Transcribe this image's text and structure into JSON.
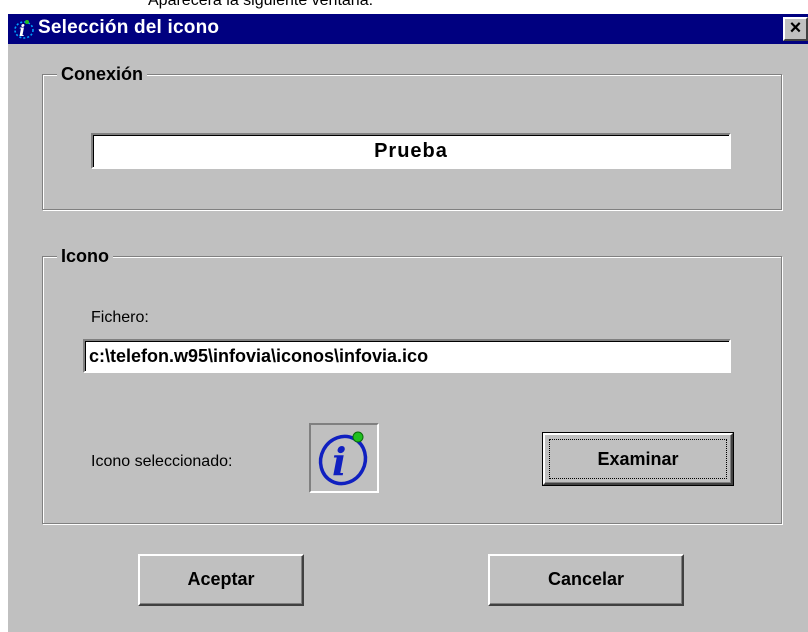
{
  "document": {
    "caption": "Aparecerá la siguiente ventana:"
  },
  "window": {
    "title": "Selección del icono",
    "title_icon": "infovia-icon",
    "close_label": "×"
  },
  "conexion": {
    "legend": "Conexión",
    "value": "Prueba"
  },
  "icono": {
    "legend": "Icono",
    "file_label": "Fichero:",
    "file_value": "c:\\telefon.w95\\infovia\\iconos\\infovia.ico",
    "selected_label": "Icono seleccionado:",
    "selected_icon": "infovia-icon",
    "browse_button": "Examinar"
  },
  "buttons": {
    "accept": "Aceptar",
    "cancel": "Cancelar"
  },
  "colors": {
    "titlebar": "#000080",
    "face": "#c0c0c0",
    "icon_blue": "#1020c0",
    "icon_dot": "#20c020"
  }
}
